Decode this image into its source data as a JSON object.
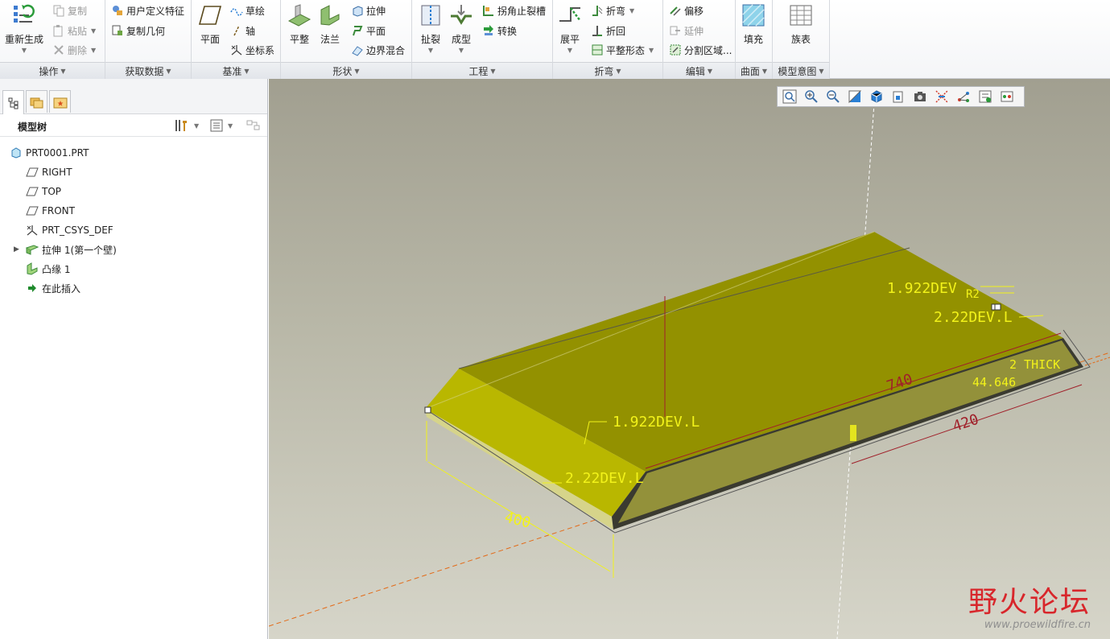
{
  "ribbon": {
    "groups": {
      "operations": {
        "label": "操作",
        "regenerate": "重新生成",
        "copy": "复制",
        "paste": "粘贴",
        "delete": "删除"
      },
      "get_data": {
        "label": "获取数据",
        "udf": "用户定义特征",
        "copy_geometry": "复制几何"
      },
      "datum": {
        "label": "基准",
        "plane": "平面",
        "sketch": "草绘",
        "axis": "轴",
        "csys": "坐标系"
      },
      "shapes": {
        "label": "形状",
        "planar": "平整",
        "flange": "法兰",
        "extrude": "拉伸",
        "flat": "平面",
        "boundary_blend": "边界混合"
      },
      "engineering": {
        "label": "工程",
        "rip": "扯裂",
        "form": "成型",
        "corner_relief": "拐角止裂槽",
        "convert": "转换"
      },
      "bends": {
        "label": "折弯",
        "unbend": "展平",
        "bend": "折弯",
        "bend_back": "折回",
        "flatten_state": "平整形态"
      },
      "editing": {
        "label": "编辑",
        "offset": "偏移",
        "extend": "延伸",
        "split_area": "分割区域..."
      },
      "surfaces": {
        "label": "曲面",
        "fill": "填充"
      },
      "model_intent": {
        "label": "模型意图",
        "family_table": "族表"
      }
    }
  },
  "model_tree": {
    "title": "模型树",
    "items": [
      {
        "label": "PRT0001.PRT",
        "icon": "part-icon"
      },
      {
        "label": "RIGHT",
        "icon": "datum-plane-icon"
      },
      {
        "label": "TOP",
        "icon": "datum-plane-icon"
      },
      {
        "label": "FRONT",
        "icon": "datum-plane-icon"
      },
      {
        "label": "PRT_CSYS_DEF",
        "icon": "csys-icon"
      },
      {
        "label": "拉伸 1(第一个壁)",
        "icon": "extrude-icon"
      },
      {
        "label": "凸缘 1",
        "icon": "flange-icon"
      },
      {
        "label": "在此插入",
        "icon": "insert-here-arrow-icon"
      }
    ]
  },
  "viewport": {
    "dimensions": {
      "dev1_top": "1.922DEV",
      "r2": "R2",
      "dev2_top": "2.22DEV.L",
      "dev1_left": "1.922DEV.L",
      "dev2_left": "2.22DEV.L",
      "len_740": "740",
      "len_420": "420",
      "len_400": "400",
      "thick": "2 THICK",
      "angle": "44.646"
    },
    "colors": {
      "top_face": "#939100",
      "side_face": "#b9b700",
      "dimension": "#f2f21a",
      "dim_red": "#a0202a"
    }
  },
  "watermark": {
    "title": "野火论坛",
    "url": "www.proewildfire.cn"
  }
}
